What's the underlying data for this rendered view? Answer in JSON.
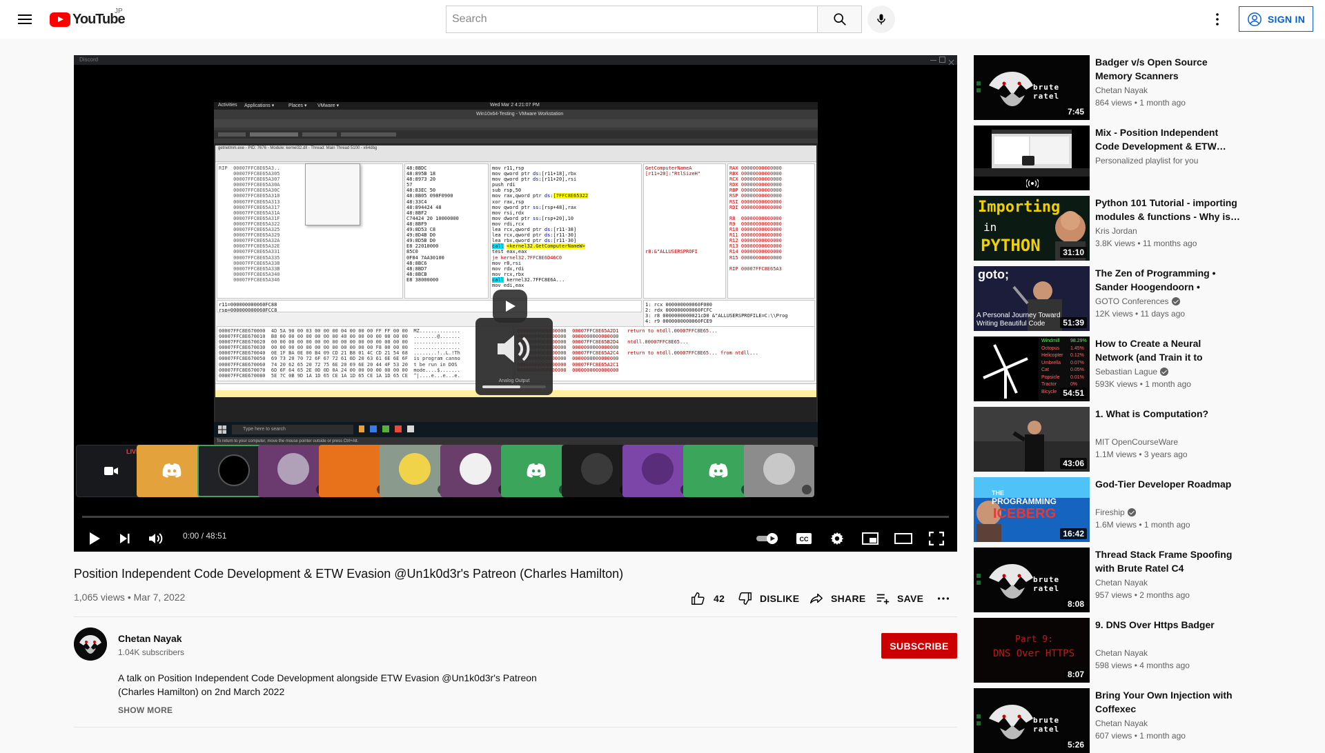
{
  "header": {
    "logo_text": "YouTube",
    "region": "JP",
    "search_placeholder": "Search",
    "signin_label": "SIGN IN"
  },
  "player": {
    "time_current": "0:00",
    "time_total": "48:51",
    "time_sep": " / ",
    "discord_title": "Discord",
    "live_label": "LIVE",
    "osd_label": "Analog Output",
    "taskbar_search": "Type here to search",
    "status_line": "To return to your computer, move the mouse pointer outside or press Ctrl+Alt.",
    "gnome_activities": "Activities",
    "gnome_applications": "Applications ▾",
    "gnome_places": "Places ▾",
    "gnome_vmware": "VMware ▾",
    "gnome_clock": "Wed Mar 2  4:21:07 PM",
    "vm_window_title": "Win10x64-Testing - VMware Workstation",
    "dbg_module": "getnetmm.exe - PID: 7676 - Module: kernel32.dll - Thread: Main Thread 5100 - x64dbg"
  },
  "video": {
    "title": "Position Independent Code Development & ETW Evasion @Un1k0d3r's Patreon (Charles Hamilton)",
    "views": "1,065 views",
    "date": "Mar 7, 2022",
    "meta_sep": " • ",
    "likes": "42",
    "dislike_label": "DISLIKE",
    "share_label": "SHARE",
    "save_label": "SAVE"
  },
  "channel": {
    "name": "Chetan Nayak",
    "subscribers": "1.04K subscribers",
    "subscribe_label": "SUBSCRIBE"
  },
  "description": {
    "line1": "A talk on Position Independent Code Development alongside ETW Evasion @Un1k0d3r's Patreon",
    "line2": "(Charles Hamilton) on 2nd March 2022",
    "show_more": "SHOW MORE"
  },
  "recommendations": [
    {
      "title": "Badger v/s Open Source Memory Scanners",
      "channel": "Chetan Nayak",
      "verified": false,
      "stats": "864 views • 1 month ago",
      "duration": "7:45",
      "thumb": "brute"
    },
    {
      "title": "Mix - Position Independent Code Development & ETW…",
      "channel": "Personalized playlist for you",
      "verified": false,
      "stats": "",
      "duration": "",
      "thumb": "mix"
    },
    {
      "title": "Python 101 Tutorial - importing modules & functions - Why is…",
      "channel": "Kris Jordan",
      "verified": false,
      "stats": "3.8K views • 11 months ago",
      "duration": "31:10",
      "thumb": "python"
    },
    {
      "title": "The Zen of Programming • Sander Hoogendoorn • GOTO…",
      "channel": "GOTO Conferences",
      "verified": true,
      "stats": "12K views • 11 days ago",
      "duration": "51:39",
      "thumb": "goto"
    },
    {
      "title": "How to Create a Neural Network (and Train it to Identi…",
      "channel": "Sebastian Lague",
      "verified": true,
      "stats": "593K views • 1 month ago",
      "duration": "54:51",
      "thumb": "neural"
    },
    {
      "title": "1. What is Computation?",
      "channel": "MIT OpenCourseWare",
      "verified": false,
      "stats": "1.1M views • 3 years ago",
      "duration": "43:06",
      "thumb": "mit"
    },
    {
      "title": "God-Tier Developer Roadmap",
      "channel": "Fireship",
      "verified": true,
      "stats": "1.6M views • 1 month ago",
      "duration": "16:42",
      "thumb": "iceberg"
    },
    {
      "title": "Thread Stack Frame Spoofing with Brute Ratel C4",
      "channel": "Chetan Nayak",
      "verified": false,
      "stats": "957 views • 2 months ago",
      "duration": "8:08",
      "thumb": "brute"
    },
    {
      "title": "9. DNS Over Https Badger",
      "channel": "Chetan Nayak",
      "verified": false,
      "stats": "598 views • 4 months ago",
      "duration": "8:07",
      "thumb": "dns"
    },
    {
      "title": "Bring Your Own Injection with Coffexec",
      "channel": "Chetan Nayak",
      "verified": false,
      "stats": "607 views • 1 month ago",
      "duration": "5:26",
      "thumb": "brute"
    }
  ],
  "thumb_text": {
    "brute": "brute ratel",
    "python_top": "Importing",
    "python_mid": "in",
    "python_bot": "PYTHON",
    "goto_logo": "goto;",
    "goto_caption1": "A Personal Journey Toward",
    "goto_caption2": "Writing Beautiful Code",
    "iceberg1": "THE",
    "iceberg2": "PROGRAMMING",
    "iceberg3": "ICEBERG",
    "dns1": "Part 9:",
    "dns2": "DNS Over HTTPS",
    "neural_labels": [
      "Windmill",
      "Octopus",
      "Helicopter",
      "Umbrella",
      "Cat",
      "Popsicle",
      "Tractor",
      "Bicycle"
    ],
    "neural_values": [
      "98.29%",
      "1.45%",
      "0.12%",
      "0.07%",
      "0.05%",
      "0.01%",
      "0%",
      ""
    ]
  },
  "colors": {
    "accent_red": "#cc0000",
    "brand_red": "#ff0000",
    "link_blue": "#065fd4",
    "discord_orange": "#faa61a",
    "discord_green": "#3ba55c",
    "discord_purple": "#9b59b6"
  }
}
